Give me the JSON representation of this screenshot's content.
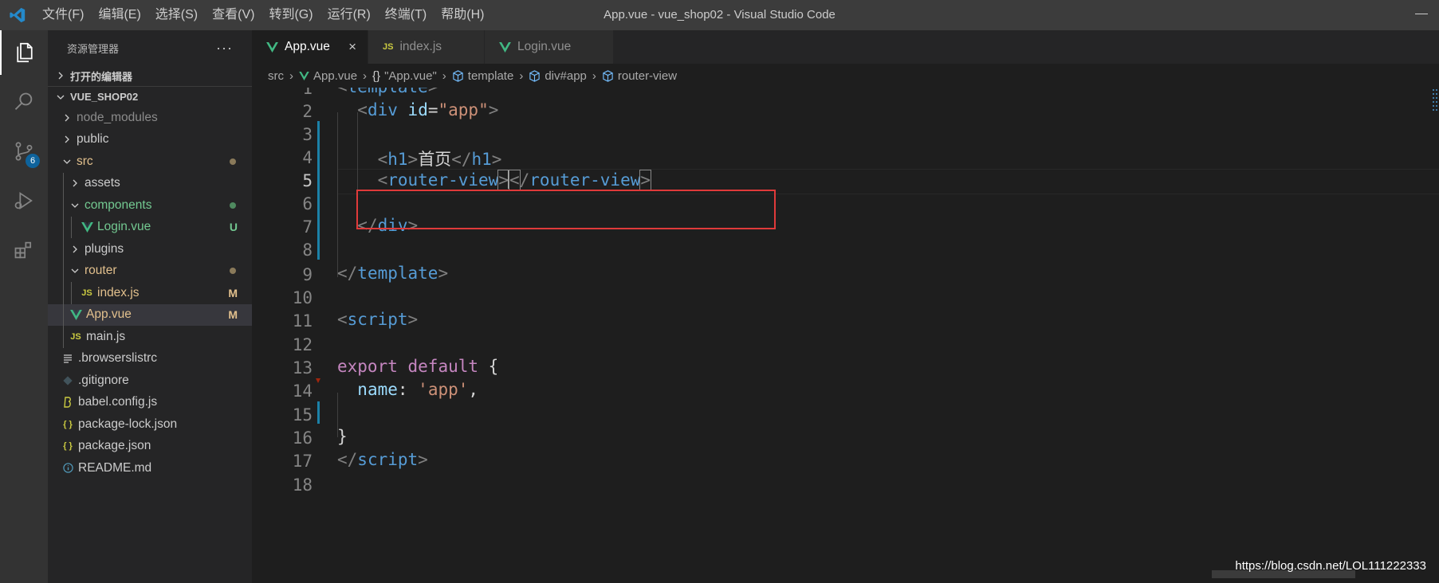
{
  "titlebar": {
    "menu": [
      "文件(F)",
      "编辑(E)",
      "选择(S)",
      "查看(V)",
      "转到(G)",
      "运行(R)",
      "终端(T)",
      "帮助(H)"
    ],
    "window_title": "App.vue - vue_shop02 - Visual Studio Code"
  },
  "activitybar": {
    "items": [
      "explorer-icon",
      "search-icon",
      "source-control-icon",
      "run-debug-icon",
      "extensions-icon"
    ],
    "scm_badge": "6"
  },
  "sidebar": {
    "title": "资源管理器",
    "more": "···",
    "open_editors": "打开的编辑器",
    "project": "VUE_SHOP02",
    "tree": [
      {
        "label": "node_modules",
        "type": "folder"
      },
      {
        "label": "public",
        "type": "folder"
      },
      {
        "label": "src",
        "type": "folder-open"
      },
      {
        "label": "assets",
        "type": "folder"
      },
      {
        "label": "components",
        "type": "folder-open"
      },
      {
        "label": "Login.vue",
        "type": "vue",
        "decoration": "U"
      },
      {
        "label": "plugins",
        "type": "folder"
      },
      {
        "label": "router",
        "type": "folder-open"
      },
      {
        "label": "index.js",
        "type": "js",
        "decoration": "M"
      },
      {
        "label": "App.vue",
        "type": "vue",
        "decoration": "M"
      },
      {
        "label": "main.js",
        "type": "js"
      },
      {
        "label": ".browserslistrc",
        "type": "lines"
      },
      {
        "label": ".gitignore",
        "type": "git"
      },
      {
        "label": "babel.config.js",
        "type": "babel"
      },
      {
        "label": "package-lock.json",
        "type": "json"
      },
      {
        "label": "package.json",
        "type": "json"
      },
      {
        "label": "README.md",
        "type": "info"
      }
    ],
    "icon_text": {
      "js": "JS",
      "json": "{ }"
    }
  },
  "tabs": [
    {
      "label": "App.vue",
      "icon": "vue-icon",
      "close": "×"
    },
    {
      "label": "index.js",
      "icon": "js-icon"
    },
    {
      "label": "Login.vue",
      "icon": "vue-icon"
    }
  ],
  "breadcrumb": [
    "src",
    "App.vue",
    "\"App.vue\"",
    "template",
    "div#app",
    "router-view"
  ],
  "breadcrumb_prefix": "{}",
  "editor": {
    "line_numbers": [
      "1",
      "2",
      "3",
      "4",
      "5",
      "6",
      "7",
      "8",
      "9",
      "10",
      "11",
      "12",
      "13",
      "14",
      "15",
      "16",
      "17",
      "18"
    ],
    "current_line": "5"
  },
  "colors": {
    "accent": "#1b81a8",
    "vue_green": "#41b883",
    "js_yellow": "#cbcb41",
    "highlight_red": "#e03a3a"
  },
  "watermark": "https://blog.csdn.net/LOL111222333"
}
